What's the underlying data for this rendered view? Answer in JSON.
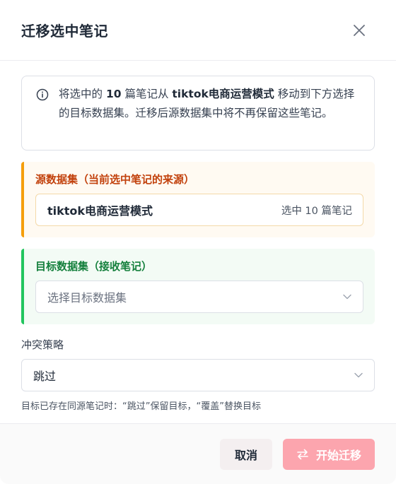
{
  "dialog": {
    "title": "迁移选中笔记"
  },
  "info": {
    "icon": "info-circle-icon",
    "text_1": "将选中的 ",
    "count": "10",
    "text_2": " 篇笔记从 ",
    "source_name": "tiktok电商运营模式",
    "text_3": " 移动到下方选择的目标数据集。迁移后源数据集中将不再保留这些笔记。"
  },
  "source": {
    "title": "源数据集（当前选中笔记的来源）",
    "name": "tiktok电商运营模式",
    "count_label": "选中 10 篇笔记",
    "accent": "#f59e0b"
  },
  "target": {
    "title": "目标数据集（接收笔记）",
    "placeholder": "选择目标数据集",
    "accent": "#22c55e"
  },
  "strategy": {
    "label": "冲突策略",
    "selected": "跳过",
    "hint": "目标已存在同源笔记时：“跳过”保留目标，“覆盖”替换目标"
  },
  "footer": {
    "cancel_label": "取消",
    "start_label": "开始迁移",
    "start_icon": "swap-arrows-icon",
    "start_color": "#fca5ae"
  }
}
